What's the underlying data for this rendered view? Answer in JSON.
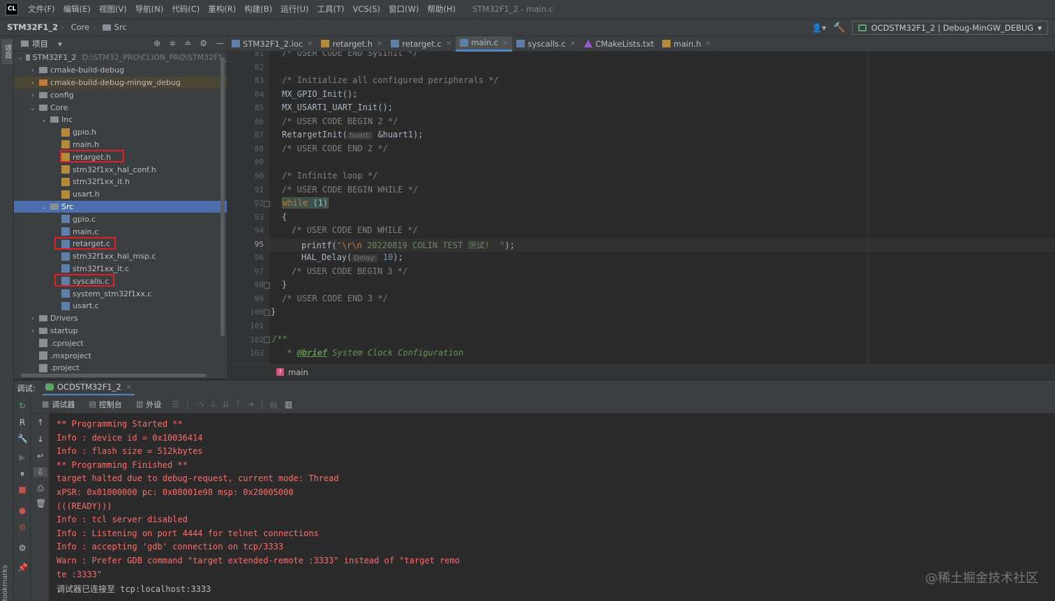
{
  "menu": {
    "logo": "CL",
    "items": [
      "文件(F)",
      "编辑(E)",
      "视图(V)",
      "导航(N)",
      "代码(C)",
      "重构(R)",
      "构建(B)",
      "运行(U)",
      "工具(T)",
      "VCS(S)",
      "窗口(W)",
      "帮助(H)"
    ],
    "window_title": "STM32F1_2 - main.c"
  },
  "navbar": {
    "project": "STM32F1_2",
    "crumb1": "Core",
    "crumb2": "Src",
    "user_icon": "user-icon",
    "run_config": "OCDSTM32F1_2 | Debug-MinGW_DEBUG"
  },
  "left_strip": {
    "project_label": "项目",
    "bookmarks_label": "Bookmarks",
    "structure_label": "结构"
  },
  "project_panel": {
    "title": "项目",
    "root_name": "STM32F1_2",
    "root_path": "D:\\STM32_PRO\\CLION_PRO\\STM32F1_",
    "tree": [
      {
        "label": "cmake-build-debug",
        "depth": 1,
        "type": "folder",
        "arrow": "›"
      },
      {
        "label": "cmake-build-debug-mingw_debug",
        "depth": 1,
        "type": "folder-orange",
        "arrow": "›"
      },
      {
        "label": "config",
        "depth": 1,
        "type": "folder",
        "arrow": "›"
      },
      {
        "label": "Core",
        "depth": 1,
        "type": "folder",
        "arrow": "⌄"
      },
      {
        "label": "Inc",
        "depth": 2,
        "type": "folder",
        "arrow": "⌄"
      },
      {
        "label": "gpio.h",
        "depth": 3,
        "type": "h"
      },
      {
        "label": "main.h",
        "depth": 3,
        "type": "h"
      },
      {
        "label": "retarget.h",
        "depth": 3,
        "type": "h"
      },
      {
        "label": "stm32f1xx_hal_conf.h",
        "depth": 3,
        "type": "h"
      },
      {
        "label": "stm32f1xx_it.h",
        "depth": 3,
        "type": "h"
      },
      {
        "label": "usart.h",
        "depth": 3,
        "type": "h"
      },
      {
        "label": "Src",
        "depth": 2,
        "type": "folder",
        "arrow": "⌄"
      },
      {
        "label": "gpio.c",
        "depth": 3,
        "type": "c"
      },
      {
        "label": "main.c",
        "depth": 3,
        "type": "c"
      },
      {
        "label": "retarget.c",
        "depth": 3,
        "type": "c"
      },
      {
        "label": "stm32f1xx_hal_msp.c",
        "depth": 3,
        "type": "c"
      },
      {
        "label": "stm32f1xx_it.c",
        "depth": 3,
        "type": "c"
      },
      {
        "label": "syscalls.c",
        "depth": 3,
        "type": "c"
      },
      {
        "label": "system_stm32f1xx.c",
        "depth": 3,
        "type": "c"
      },
      {
        "label": "usart.c",
        "depth": 3,
        "type": "c"
      },
      {
        "label": "Drivers",
        "depth": 1,
        "type": "folder",
        "arrow": "›"
      },
      {
        "label": "startup",
        "depth": 1,
        "type": "folder",
        "arrow": "›"
      },
      {
        "label": ".cproject",
        "depth": 1,
        "type": "doc"
      },
      {
        "label": ".mxproject",
        "depth": 1,
        "type": "doc"
      },
      {
        "label": ".project",
        "depth": 1,
        "type": "doc"
      }
    ]
  },
  "tabs": [
    {
      "label": "STM32F1_2.ioc",
      "icon": "c",
      "close": "×"
    },
    {
      "label": "retarget.h",
      "icon": "h",
      "close": "×"
    },
    {
      "label": "retarget.c",
      "icon": "c",
      "close": "×"
    },
    {
      "label": "main.c",
      "icon": "c",
      "close": "×"
    },
    {
      "label": "syscalls.c",
      "icon": "c",
      "close": "×"
    },
    {
      "label": "CMakeLists.txt",
      "icon": "tri",
      "close": ""
    },
    {
      "label": "main.h",
      "icon": "h",
      "close": "×"
    }
  ],
  "editor": {
    "line_numbers": [
      "81",
      "82",
      "83",
      "84",
      "85",
      "86",
      "87",
      "88",
      "89",
      "90",
      "91",
      "92",
      "93",
      "94",
      "95",
      "96",
      "97",
      "98",
      "99",
      "100",
      "101",
      "102",
      "103"
    ],
    "current_line": "95",
    "lines": {
      "l81": "/* USER CODE END SysInit */",
      "l83": "/* Initialize all configured peripherals */",
      "l84": "MX_GPIO_Init();",
      "l85": "MX_USART1_UART_Init();",
      "l86": "/* USER CODE BEGIN 2 */",
      "l87_fn": "RetargetInit(",
      "l87_hint": "huart:",
      "l87_arg": " &huart1);",
      "l88": "/* USER CODE END 2 */",
      "l90": "/* Infinite loop */",
      "l91": "/* USER CODE BEGIN WHILE */",
      "l92_kw": "while",
      "l92_num": " (1)",
      "l93": "{",
      "l94": "/* USER CODE END WHILE */",
      "l95_fn": "printf(",
      "l95_q1": "\"",
      "l95_esc": "\\r\\n",
      "l95_str": " 20220819 COLIN TEST 测试!  \"",
      "l95_end": ");",
      "l96_fn": "HAL_Delay(",
      "l96_hint": "Delay:",
      "l96_num": " 10",
      "l96_end": ");",
      "l97": "/* USER CODE BEGIN 3 */",
      "l98": "}",
      "l99": "/* USER CODE END 3 */",
      "l100": "}",
      "l102": "/**",
      "l103_star": " * ",
      "l103_tag": "@brief",
      "l103_text": " System Clock Configuration"
    },
    "breadcrumb_fn": "main",
    "fn_badge": "f"
  },
  "debug": {
    "label": "调试:",
    "session": "OCDSTM32F1_2",
    "tab_debugger": "调试器",
    "tab_console": "控制台",
    "tab_peripherals": "外设",
    "console_lines": [
      {
        "text": "** Programming Started **",
        "kind": "err"
      },
      {
        "text": "Info : device id = 0x10036414",
        "kind": "err"
      },
      {
        "text": "Info : flash size = 512kbytes",
        "kind": "err"
      },
      {
        "text": "** Programming Finished **",
        "kind": "err"
      },
      {
        "text": "target halted due to debug-request, current mode: Thread",
        "kind": "err"
      },
      {
        "text": "xPSR: 0x01000000 pc: 0x08001e98 msp: 0x20005000",
        "kind": "err"
      },
      {
        "text": "(((READY)))",
        "kind": "err"
      },
      {
        "text": "Info : tcl server disabled",
        "kind": "err"
      },
      {
        "text": "Info : Listening on port 4444 for telnet connections",
        "kind": "err"
      },
      {
        "text": "Info : accepting 'gdb' connection on tcp/3333",
        "kind": "err"
      },
      {
        "text": "Warn : Prefer GDB command \"target extended-remote :3333\" instead of \"target remo",
        "kind": "err"
      },
      {
        "text": "te :3333\"",
        "kind": "err"
      },
      {
        "text": "调试器已连接至 tcp:localhost:3333",
        "kind": "plain"
      }
    ]
  },
  "watermark": "@稀土掘金技术社区",
  "colors": {
    "accent": "#4a88c7",
    "selection": "#4b6eaf",
    "error_text": "#ff6b68",
    "highlight_box": "#e02020"
  }
}
